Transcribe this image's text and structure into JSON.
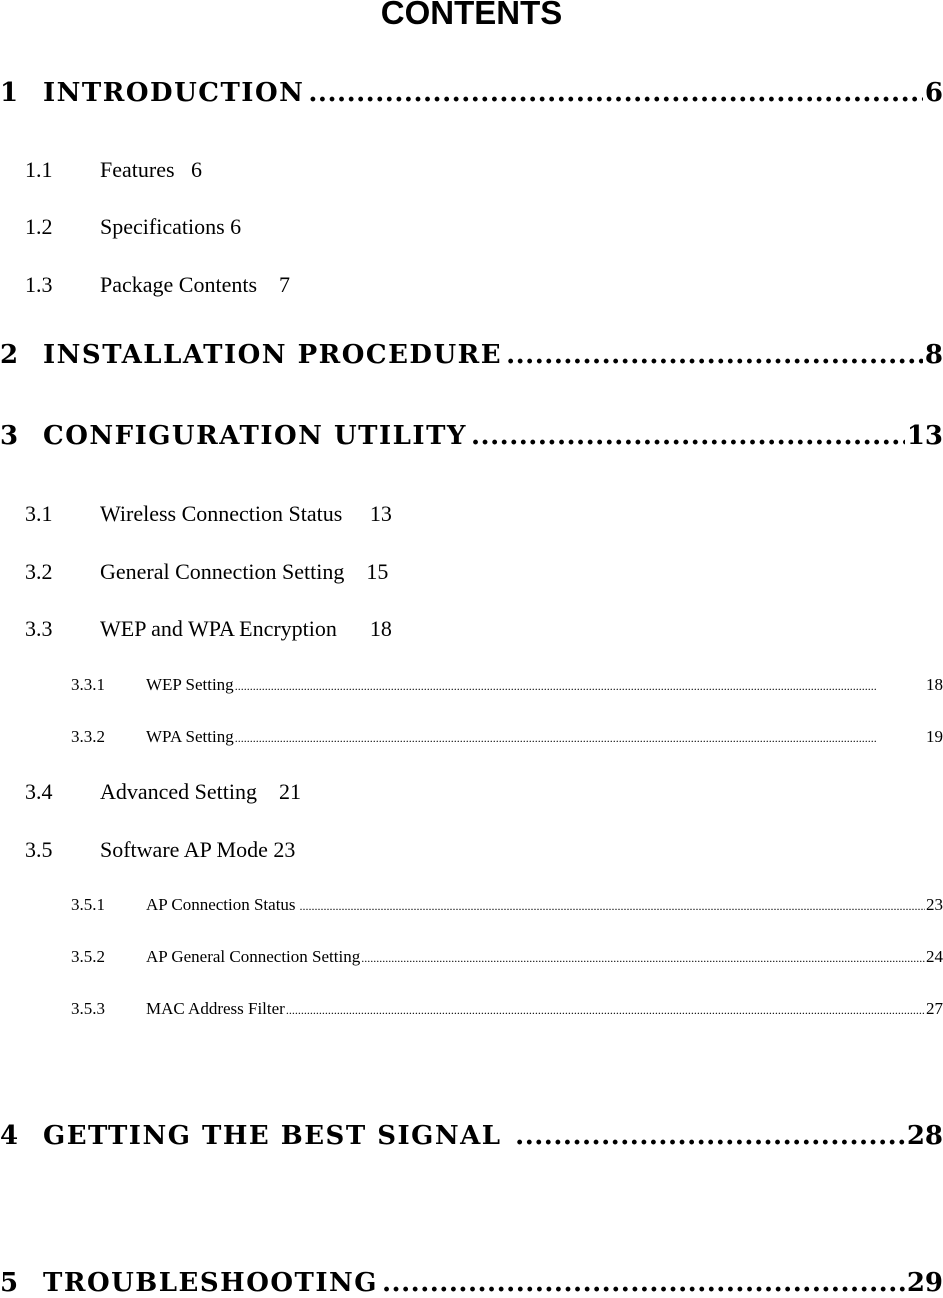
{
  "title": "CONTENTS",
  "entries": [
    {
      "num": "1",
      "label": "INTRODUCTION",
      "page": "6"
    },
    {
      "num": "1.1",
      "label": "Features",
      "page": "6"
    },
    {
      "num": "1.2",
      "label": "Specifications",
      "page": "6"
    },
    {
      "num": "1.3",
      "label": "Package Contents",
      "page": "7"
    },
    {
      "num": "2",
      "label": "INSTALLATION PROCEDURE",
      "page": "8"
    },
    {
      "num": "3",
      "label": "CONFIGURATION UTILITY",
      "page": "13"
    },
    {
      "num": "3.1",
      "label": "Wireless Connection Status",
      "page": "13"
    },
    {
      "num": "3.2",
      "label": "General Connection Setting",
      "page": "15"
    },
    {
      "num": "3.3",
      "label": "WEP and WPA Encryption",
      "page": "18"
    },
    {
      "num": "3.3.1",
      "label": "WEP Setting",
      "page": "18"
    },
    {
      "num": "3.3.2",
      "label": "WPA Setting",
      "page": "19"
    },
    {
      "num": "3.4",
      "label": "Advanced Setting",
      "page": "21"
    },
    {
      "num": "3.5",
      "label": "Software AP Mode",
      "page": "23"
    },
    {
      "num": "3.5.1",
      "label": "AP Connection Status",
      "page": "23"
    },
    {
      "num": "3.5.2",
      "label": "AP General Connection Setting",
      "page": "24"
    },
    {
      "num": "3.5.3",
      "label": "MAC Address Filter",
      "page": "27"
    },
    {
      "num": "4",
      "label": "GETTING THE BEST SIGNAL",
      "page": "28"
    },
    {
      "num": "5",
      "label": "TROUBLESHOOTING",
      "page": "29"
    }
  ]
}
